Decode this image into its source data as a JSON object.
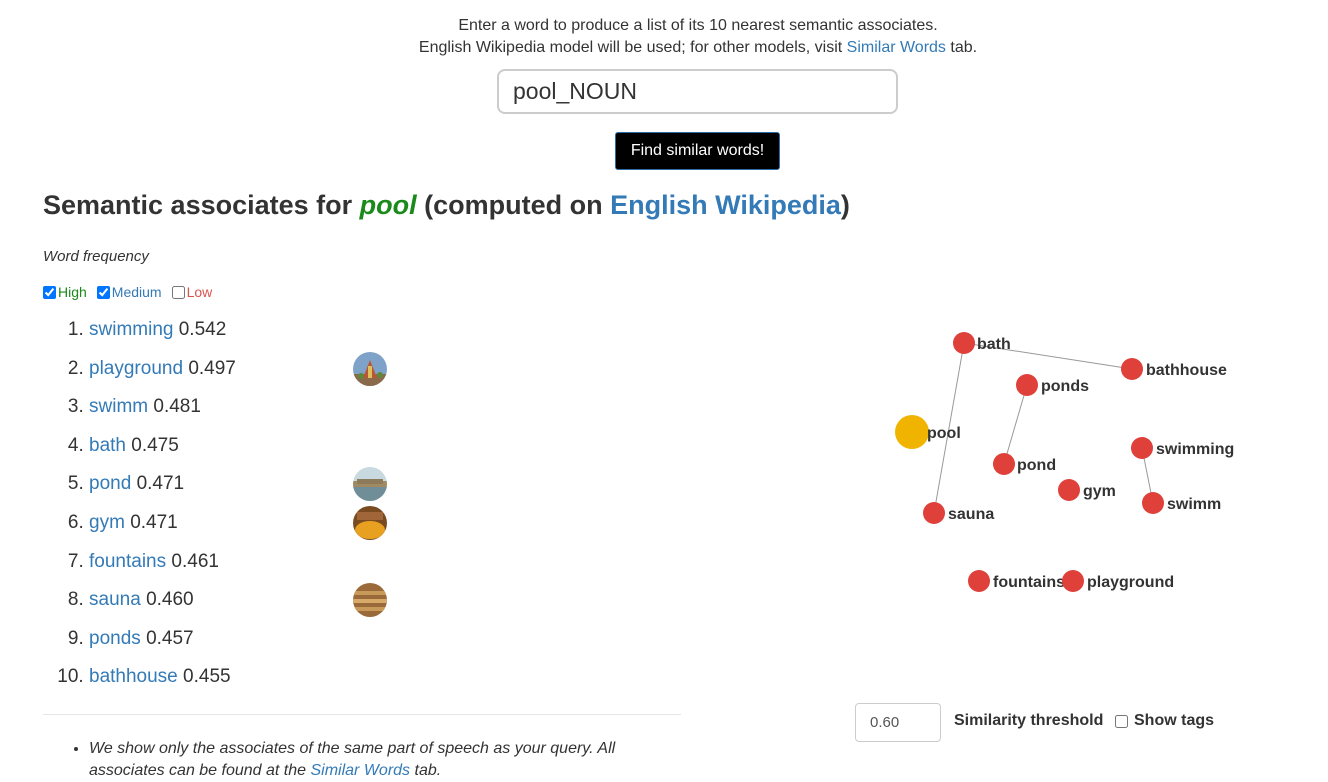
{
  "intro": {
    "line1": "Enter a word to produce a list of its 10 nearest semantic associates.",
    "line2_prefix": "English Wikipedia model will be used; for other models, visit ",
    "line2_link": "Similar Words",
    "line2_suffix": " tab."
  },
  "search": {
    "value": "pool_NOUN"
  },
  "find_button": "Find similar words!",
  "heading": {
    "prefix": "Semantic associates for ",
    "query": "pool",
    "middle": " (computed on ",
    "model": "English Wikipedia",
    "suffix": ")"
  },
  "frequency": {
    "label": "Word frequency",
    "high": {
      "label": "High",
      "checked": true
    },
    "medium": {
      "label": "Medium",
      "checked": true
    },
    "low": {
      "label": "Low",
      "checked": false
    }
  },
  "associates": [
    {
      "word": "swimming",
      "score": "0.542",
      "thumb": "none"
    },
    {
      "word": "playground",
      "score": "0.497",
      "thumb": "playground-photo"
    },
    {
      "word": "swimm",
      "score": "0.481",
      "thumb": "none"
    },
    {
      "word": "bath",
      "score": "0.475",
      "thumb": "none"
    },
    {
      "word": "pond",
      "score": "0.471",
      "thumb": "pond-photo"
    },
    {
      "word": "gym",
      "score": "0.471",
      "thumb": "gym-photo"
    },
    {
      "word": "fountains",
      "score": "0.461",
      "thumb": "none"
    },
    {
      "word": "sauna",
      "score": "0.460",
      "thumb": "sauna-photo"
    },
    {
      "word": "ponds",
      "score": "0.457",
      "thumb": "none"
    },
    {
      "word": "bathhouse",
      "score": "0.455",
      "thumb": "none"
    }
  ],
  "notes": {
    "text1": "We show only the associates of the same part of speech as your query. All associates can be found at the ",
    "link": "Similar Words",
    "text2": " tab."
  },
  "graph": {
    "query_color": "#f0b400",
    "node_color": "#e0403a",
    "nodes": [
      "pool",
      "bath",
      "bathhouse",
      "ponds",
      "pond",
      "swimming",
      "swimm",
      "gym",
      "sauna",
      "fountains",
      "playground"
    ],
    "edges": [
      [
        "bath",
        "bathhouse"
      ],
      [
        "bath",
        "sauna"
      ],
      [
        "ponds",
        "pond"
      ],
      [
        "swimming",
        "swimm"
      ]
    ]
  },
  "threshold": {
    "value": "0.60",
    "label": "Similarity threshold"
  },
  "show_tags": {
    "label": "Show tags",
    "checked": false
  }
}
